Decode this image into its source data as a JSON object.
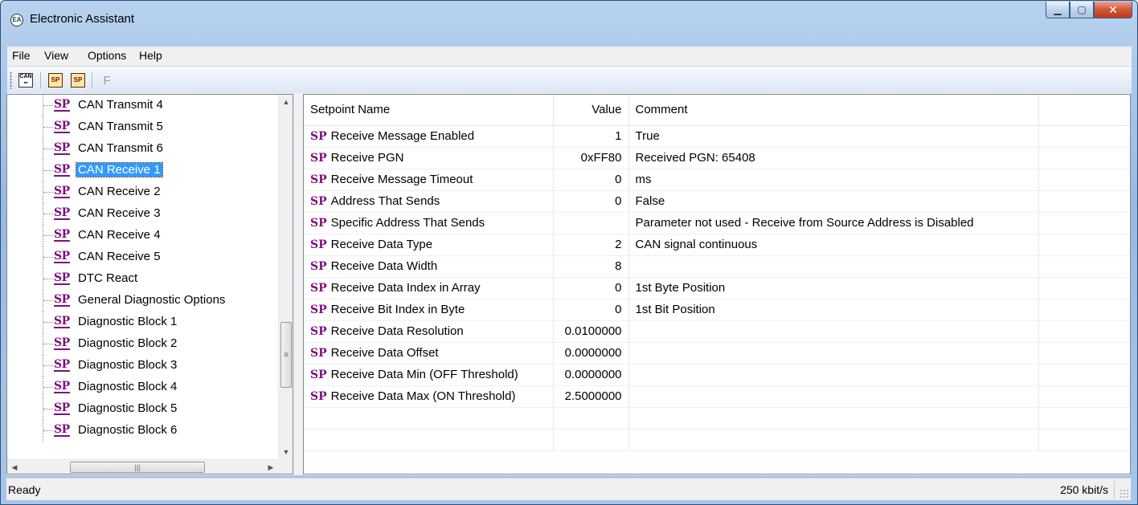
{
  "window": {
    "title": "Electronic Assistant"
  },
  "menu": [
    "File",
    "View",
    "Options",
    "Help"
  ],
  "toolbar": {
    "f_label": "F"
  },
  "tree": {
    "items": [
      {
        "label": "CAN Transmit 4",
        "selected": false
      },
      {
        "label": "CAN Transmit 5",
        "selected": false
      },
      {
        "label": "CAN Transmit 6",
        "selected": false
      },
      {
        "label": "CAN Receive 1",
        "selected": true
      },
      {
        "label": "CAN Receive 2",
        "selected": false
      },
      {
        "label": "CAN Receive 3",
        "selected": false
      },
      {
        "label": "CAN Receive 4",
        "selected": false
      },
      {
        "label": "CAN Receive 5",
        "selected": false
      },
      {
        "label": "DTC React",
        "selected": false
      },
      {
        "label": "General Diagnostic Options",
        "selected": false
      },
      {
        "label": "Diagnostic Block 1",
        "selected": false
      },
      {
        "label": "Diagnostic Block 2",
        "selected": false
      },
      {
        "label": "Diagnostic Block 3",
        "selected": false
      },
      {
        "label": "Diagnostic Block 4",
        "selected": false
      },
      {
        "label": "Diagnostic Block 5",
        "selected": false
      },
      {
        "label": "Diagnostic Block 6",
        "selected": false
      }
    ],
    "sp_badge": "SP"
  },
  "grid": {
    "headers": {
      "name": "Setpoint Name",
      "value": "Value",
      "comment": "Comment"
    },
    "rows": [
      {
        "name": "Receive Message Enabled",
        "value": "1",
        "comment": "True"
      },
      {
        "name": "Receive PGN",
        "value": "0xFF80",
        "comment": "Received PGN: 65408"
      },
      {
        "name": "Receive Message Timeout",
        "value": "0",
        "comment": "ms"
      },
      {
        "name": "Address That Sends",
        "value": "0",
        "comment": "False"
      },
      {
        "name": "Specific Address That Sends",
        "value": "",
        "comment": "Parameter not used - Receive from Source Address is Disabled"
      },
      {
        "name": "Receive Data Type",
        "value": "2",
        "comment": "CAN signal continuous"
      },
      {
        "name": "Receive Data Width",
        "value": "8",
        "comment": ""
      },
      {
        "name": "Receive Data Index in Array",
        "value": "0",
        "comment": "1st Byte Position"
      },
      {
        "name": "Receive Bit Index in Byte",
        "value": "0",
        "comment": "1st Bit Position"
      },
      {
        "name": "Receive Data Resolution",
        "value": "0.0100000",
        "comment": ""
      },
      {
        "name": "Receive Data Offset",
        "value": "0.0000000",
        "comment": ""
      },
      {
        "name": "Receive Data Min (OFF Threshold)",
        "value": "0.0000000",
        "comment": ""
      },
      {
        "name": "Receive Data Max (ON Threshold)",
        "value": "2.5000000",
        "comment": ""
      }
    ],
    "empty_rows": 2
  },
  "status": {
    "text": "Ready",
    "rate": "250 kbit/s"
  },
  "colors": {
    "sp_badge": "#7d0f7d",
    "selection": "#3399ff"
  }
}
